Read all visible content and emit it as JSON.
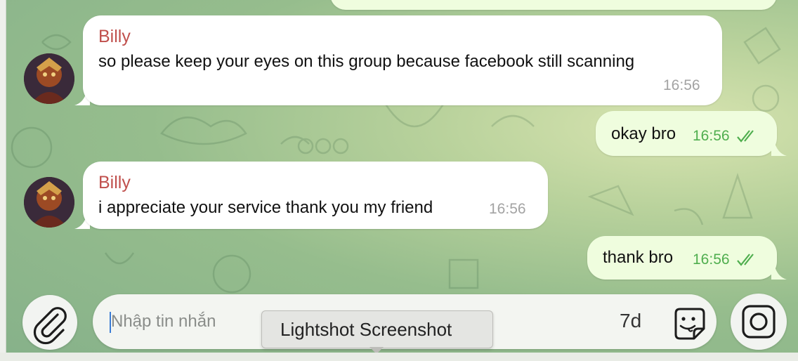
{
  "messages": [
    {
      "direction": "in",
      "sender": "Billy",
      "text": "so please keep your eyes on this group because facebook still scanning",
      "time": "16:56"
    },
    {
      "direction": "out",
      "text": "okay bro",
      "time": "16:56",
      "status": "read"
    },
    {
      "direction": "in",
      "sender": "Billy",
      "text": "i appreciate your service thank you my friend",
      "time": "16:56"
    },
    {
      "direction": "out",
      "text": "thank bro",
      "time": "16:56",
      "status": "read"
    }
  ],
  "composer": {
    "placeholder": "Nhập tin nhắn",
    "timer_label": "7d",
    "attach_icon": "paperclip-icon",
    "sticker_icon": "sticker-face-icon",
    "camera_icon": "instagram-camera-icon"
  },
  "tooltip": {
    "text": "Lightshot Screenshot"
  },
  "colors": {
    "incoming_bubble": "#ffffff",
    "outgoing_bubble": "#effdde",
    "sender_name": "#c0504d",
    "outgoing_time": "#4fae4e",
    "incoming_time": "#a3a3a3"
  }
}
